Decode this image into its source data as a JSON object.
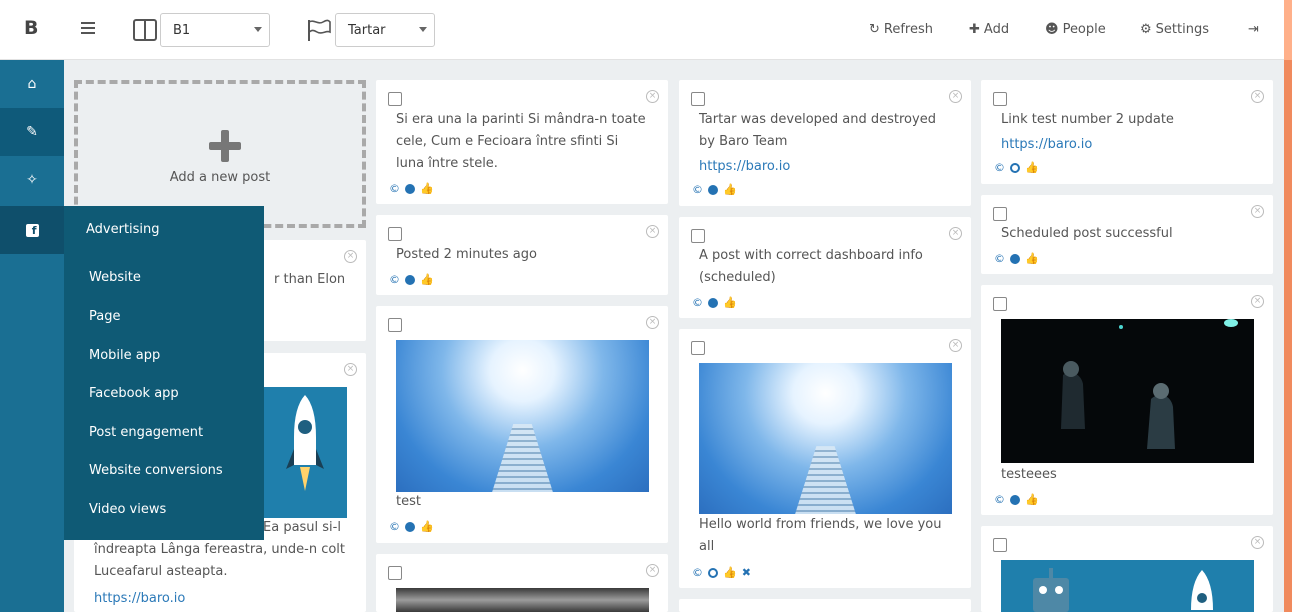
{
  "header": {
    "logo": "B",
    "board_select": "B1",
    "project_select": "Tartar",
    "nav": [
      {
        "label": "Refresh",
        "icon": "refresh-icon",
        "glyph": "↻"
      },
      {
        "label": "Add",
        "icon": "plus-icon",
        "glyph": "✚"
      },
      {
        "label": "People",
        "icon": "user-icon",
        "glyph": "☻"
      },
      {
        "label": "Settings",
        "icon": "gears-icon",
        "glyph": "⚙"
      }
    ],
    "logout_glyph": "⇥"
  },
  "sidebar": {
    "home_glyph": "⌂",
    "edit_glyph": "✎",
    "wand_glyph": "✧",
    "fb_glyph": "f"
  },
  "dropdown": {
    "title": "Advertising",
    "items": [
      "Website",
      "Page",
      "Mobile app",
      "Facebook app",
      "Post engagement",
      "Website conversions",
      "Video views"
    ]
  },
  "add_post": {
    "label": "Add a new post"
  },
  "posts": {
    "col1_a": {
      "text_partial": "r than Elon"
    },
    "col1_b": {
      "text": "Ea pasul si-l îndreapta Lânga fereastra, unde-n colt Luceafarul asteapta.",
      "text_line1": "Ea pasul si-l",
      "text_line2": "îndreapta Lânga fereastra, unde-n colt",
      "text_line3": "Luceafarul asteapta.",
      "link": "https://baro.io"
    },
    "col2_a": {
      "text": "Si era una la parinti Si mândra-n toate cele, Cum e Fecioara între sfinti Si luna între stele."
    },
    "col2_b": {
      "text": "Posted 2 minutes ago"
    },
    "col2_c": {
      "text": "test"
    },
    "col3_a": {
      "text": "Tartar was developed and destroyed by Baro Team",
      "link": "https://baro.io"
    },
    "col3_b": {
      "text": "A post with correct dashboard info (scheduled)"
    },
    "col3_c": {
      "text": "Hello world from friends, we love you all"
    },
    "col4_a": {
      "text": "Link test number 2 update",
      "link": "https://baro.io"
    },
    "col4_b": {
      "text": "Scheduled post successful"
    },
    "col4_c": {
      "text": "testeees"
    }
  },
  "glyphs": {
    "copyright": "©",
    "thumb": "👍",
    "close": "×",
    "x": "✖"
  },
  "colors": {
    "sidebar": "#1a6f93",
    "dropdown": "#0f5a75",
    "accent": "#2472b3",
    "link": "#2b79b8"
  }
}
